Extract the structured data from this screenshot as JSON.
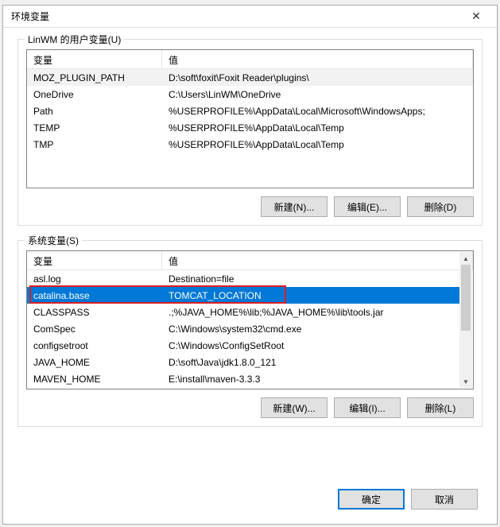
{
  "dialog": {
    "title": "环境变量"
  },
  "user_vars": {
    "group_label": "LinWM 的用户变量(U)",
    "header_var": "变量",
    "header_val": "值",
    "rows": [
      {
        "var": "MOZ_PLUGIN_PATH",
        "val": "D:\\soft\\foxit\\Foxit Reader\\plugins\\"
      },
      {
        "var": "OneDrive",
        "val": "C:\\Users\\LinWM\\OneDrive"
      },
      {
        "var": "Path",
        "val": "%USERPROFILE%\\AppData\\Local\\Microsoft\\WindowsApps;"
      },
      {
        "var": "TEMP",
        "val": "%USERPROFILE%\\AppData\\Local\\Temp"
      },
      {
        "var": "TMP",
        "val": "%USERPROFILE%\\AppData\\Local\\Temp"
      }
    ],
    "btn_new": "新建(N)...",
    "btn_edit": "编辑(E)...",
    "btn_delete": "删除(D)"
  },
  "sys_vars": {
    "group_label": "系统变量(S)",
    "header_var": "变量",
    "header_val": "值",
    "rows": [
      {
        "var": "asl.log",
        "val": "Destination=file"
      },
      {
        "var": "catalina.base",
        "val": "TOMCAT_LOCATION",
        "selected": true
      },
      {
        "var": "CLASSPASS",
        "val": ".;%JAVA_HOME%\\lib;%JAVA_HOME%\\lib\\tools.jar"
      },
      {
        "var": "ComSpec",
        "val": "C:\\Windows\\system32\\cmd.exe"
      },
      {
        "var": "configsetroot",
        "val": "C:\\Windows\\ConfigSetRoot"
      },
      {
        "var": "JAVA_HOME",
        "val": "D:\\soft\\Java\\jdk1.8.0_121"
      },
      {
        "var": "MAVEN_HOME",
        "val": "E:\\install\\maven-3.3.3"
      }
    ],
    "btn_new": "新建(W)...",
    "btn_edit": "编辑(I)...",
    "btn_delete": "删除(L)"
  },
  "footer": {
    "ok": "确定",
    "cancel": "取消"
  }
}
